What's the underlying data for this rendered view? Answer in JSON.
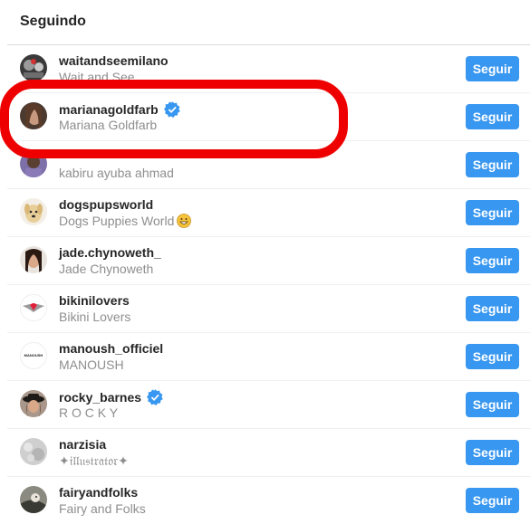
{
  "header": {
    "title": "Seguindo"
  },
  "follow_label": "Seguir",
  "colors": {
    "accent": "#3897f0",
    "highlight": "#ee0000",
    "verified": "#3897f0"
  },
  "rows": [
    {
      "username": "waitandseemilano",
      "fullname": "Wait and See",
      "verified": false
    },
    {
      "username": "marianagoldfarb",
      "fullname": "Mariana Goldfarb",
      "verified": true
    },
    {
      "username": "",
      "fullname": "kabiru ayuba ahmad",
      "verified": false
    },
    {
      "username": "dogspupsworld",
      "fullname": "Dogs Puppies World",
      "verified": false
    },
    {
      "username": "jade.chynoweth_",
      "fullname": "Jade Chynoweth",
      "verified": false
    },
    {
      "username": "bikinilovers",
      "fullname": "Bikini Lovers",
      "verified": false
    },
    {
      "username": "manoush_officiel",
      "fullname": "MANOUSH",
      "verified": false
    },
    {
      "username": "rocky_barnes",
      "fullname": "R O C K Y",
      "verified": true
    },
    {
      "username": "narzisia",
      "fullname": "✦𝔦𝔩𝔩𝔲𝔰𝔱𝔯𝔞𝔱𝔬𝔯✦",
      "verified": false
    },
    {
      "username": "fairyandfolks",
      "fullname": "Fairy and Folks",
      "verified": false
    }
  ],
  "avatar_logo_text": "MANOUSH"
}
